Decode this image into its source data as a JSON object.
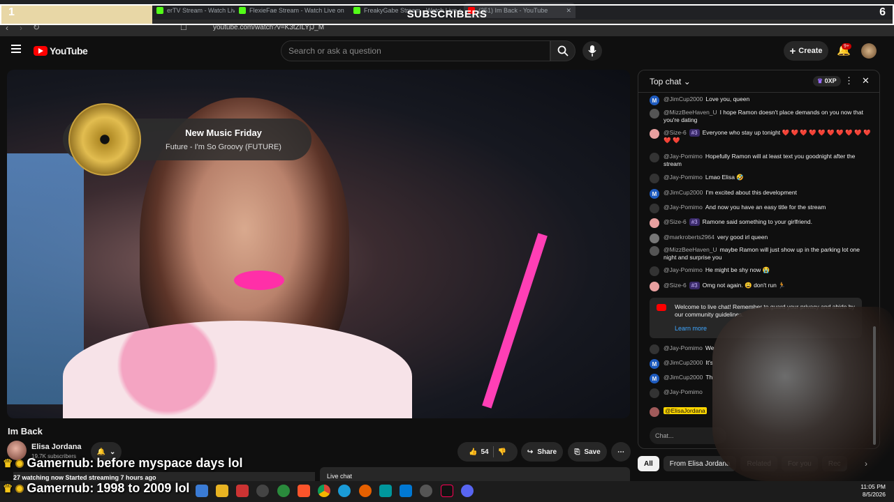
{
  "overlay": {
    "sub_left": "1",
    "sub_right": "6",
    "sub_title": "SUBSCRIBERS"
  },
  "browser": {
    "tabs": [
      {
        "label": "erTV Stream - Watch Live on",
        "color": "#53fc18"
      },
      {
        "label": "FlexieFae Stream - Watch Live on Kic",
        "color": "#53fc18"
      },
      {
        "label": "FreakyGabe Stream - Watch Live on",
        "color": "#53fc18"
      },
      {
        "label": "(251) Im Back - YouTube",
        "color": "#ff0000"
      }
    ],
    "url": "youtube.com/watch?v=K3tZILYjJ_M"
  },
  "header": {
    "logo": "YouTube",
    "search_placeholder": "Search or ask a question",
    "create_label": "Create",
    "notif_count": "9+"
  },
  "video": {
    "music_title": "New Music Friday",
    "music_track": "Future - I'm So Groovy (FUTURE)",
    "title": "Im Back",
    "channel": "Elisa Jordana",
    "subscribers": "19.7K subscribers",
    "likes": "54",
    "share_label": "Share",
    "save_label": "Save",
    "watching": "27 watching now  Started streaming 7 hours ago",
    "live_chat_label": "Live chat"
  },
  "stream_overlay": {
    "line1_user": "Gamernub:",
    "line1_text": "before myspace days lol",
    "line2_user": "Gamernub:",
    "line2_text": "1998 to 2009 lol"
  },
  "chat": {
    "header": "Top chat",
    "points": "0XP",
    "messages": [
      {
        "author": "@JimCup2000",
        "text": "Love you, queen",
        "badge": "",
        "av": "M",
        "avcolor": "#1e5bbf"
      },
      {
        "author": "@MizzBeeHaven_U",
        "text": "I hope Ramon doesn't place demands on you now that you're dating",
        "badge": "",
        "av": "",
        "avcolor": "#555"
      },
      {
        "author": "@Size-6",
        "text": "Everyone who stay up tonight ❤️ ❤️ ❤️ ❤️ ❤️ ❤️ ❤️ ❤️ ❤️ ❤️ ❤️ ❤️",
        "badge": "#3",
        "av": "",
        "avcolor": "#e8a0a0"
      },
      {
        "author": "@Jay-Pomimo",
        "text": "Hopefully Ramon will at least text you goodnight after the stream",
        "badge": "",
        "av": "",
        "avcolor": "#333"
      },
      {
        "author": "@Jay-Pomimo",
        "text": "Lmao Elisa 🤣",
        "badge": "",
        "av": "",
        "avcolor": "#333"
      },
      {
        "author": "@JimCup2000",
        "text": "I'm excited about this development",
        "badge": "",
        "av": "M",
        "avcolor": "#1e5bbf"
      },
      {
        "author": "@Jay-Pomimo",
        "text": "And now you have an easy title for the stream",
        "badge": "",
        "av": "",
        "avcolor": "#333"
      },
      {
        "author": "@Size-6",
        "text": "Ramone said something to your girlfriend.",
        "badge": "#3",
        "av": "",
        "avcolor": "#e8a0a0"
      },
      {
        "author": "@markroberts2964",
        "text": "very good irl queen",
        "badge": "",
        "av": "",
        "avcolor": "#777"
      },
      {
        "author": "@MizzBeeHaven_U",
        "text": "maybe Ramon will just show up in the parking lot one night and surprise you",
        "badge": "",
        "av": "",
        "avcolor": "#555"
      },
      {
        "author": "@Jay-Pomimo",
        "text": "He might be shy now 😭",
        "badge": "",
        "av": "",
        "avcolor": "#333"
      },
      {
        "author": "@Size-6",
        "text": "Omg not again. 😩 don't run 🏃",
        "badge": "#3",
        "av": "",
        "avcolor": "#e8a0a0"
      }
    ],
    "welcome": "Welcome to live chat! Remember to guard your privacy and abide by our community guidelines.",
    "learn_more": "Learn more",
    "later": [
      {
        "author": "@Jay-Pomimo",
        "text": "We",
        "av": "",
        "avcolor": "#333"
      },
      {
        "author": "@JimCup2000",
        "text": "It's",
        "av": "M",
        "avcolor": "#1e5bbf"
      },
      {
        "author": "@JimCup2000",
        "text": "Th",
        "av": "M",
        "avcolor": "#1e5bbf"
      },
      {
        "author": "@Jay-Pomimo",
        "text": "",
        "av": "",
        "avcolor": "#333"
      }
    ],
    "owner": "@ElisaJordana",
    "input_placeholder": "Chat...",
    "chips": [
      "All",
      "From Elisa Jordana",
      "Related",
      "For you",
      "Rec"
    ]
  },
  "taskbar": {
    "time": "11:05 PM",
    "date": "8/5/2026"
  }
}
